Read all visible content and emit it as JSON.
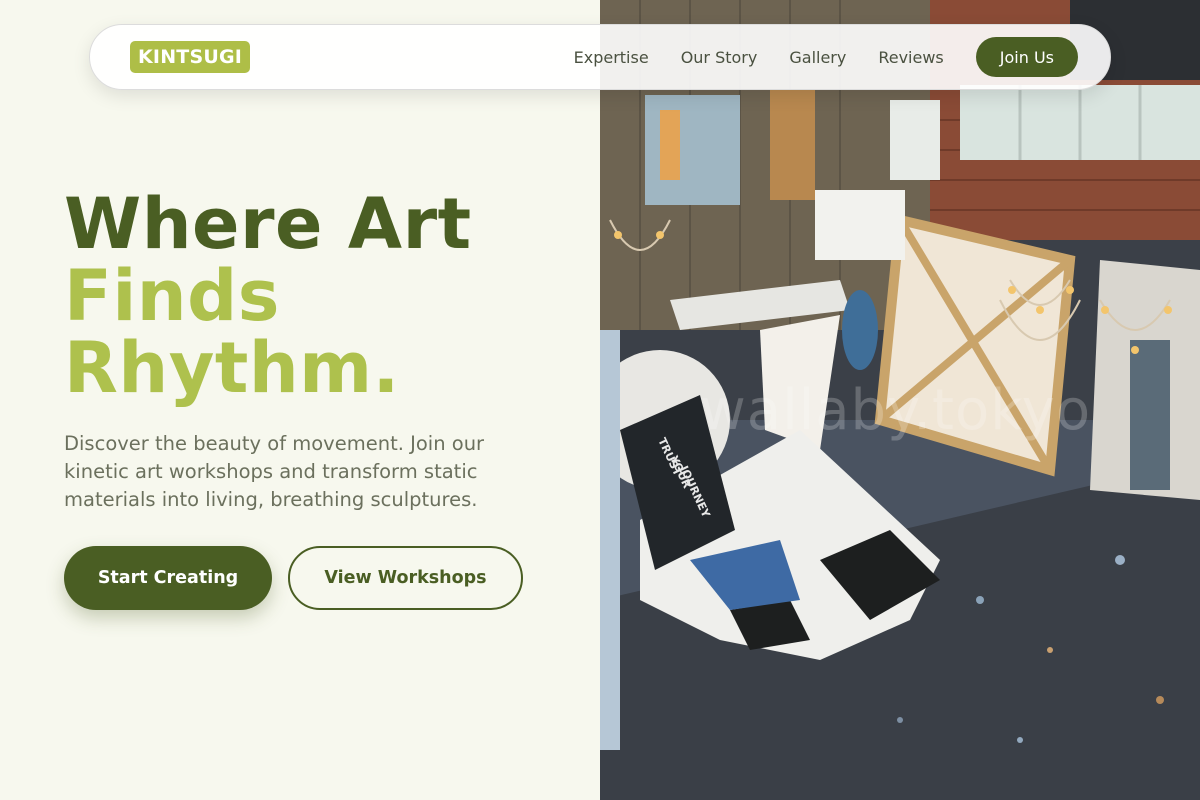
{
  "brand": {
    "logo_text": "KINTSUGI",
    "accent": "#aebe47",
    "primary": "#4a5e23"
  },
  "nav": {
    "links": [
      "Expertise",
      "Our Story",
      "Gallery",
      "Reviews"
    ],
    "cta_label": "Join Us"
  },
  "hero": {
    "title_line1": "Where Art",
    "title_line2": "Finds",
    "title_line3": "Rhythm.",
    "description": "Discover the beauty of movement. Join our kinetic art workshops and transform static materials into living, breathing sculptures.",
    "primary_button": "Start Creating",
    "secondary_button": "View Workshops"
  },
  "image": {
    "watermark": "wallaby.tokyo"
  }
}
